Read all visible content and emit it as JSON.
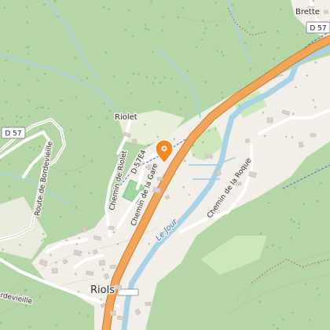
{
  "map": {
    "colors": {
      "forest": "#b5d6a6",
      "landuse": "#f2efe9",
      "meadow": "#cde8bd",
      "main_road": "#f3a65a",
      "minor_road": "#ffffff",
      "river": "#a8d3e6",
      "marker": "#f28a24"
    },
    "labels": {
      "riolet": "Riolet",
      "riols": "Riols",
      "brette": "Brette",
      "route_bordevieille": "Route de Bordevieille",
      "chemin_riolet": "Chemin de Riolet",
      "chemin_gare": "Chemin de la Gare",
      "chemin_roque": "Chemin de la Roque",
      "river_jour": "Le Jour",
      "bordevieille_partial": "rdevieille"
    },
    "road_refs": {
      "d57_left": "D 57",
      "d57_right": "D 57",
      "d57e4": "D 57E4"
    },
    "marker": {
      "icon": "map-pin-icon"
    }
  }
}
